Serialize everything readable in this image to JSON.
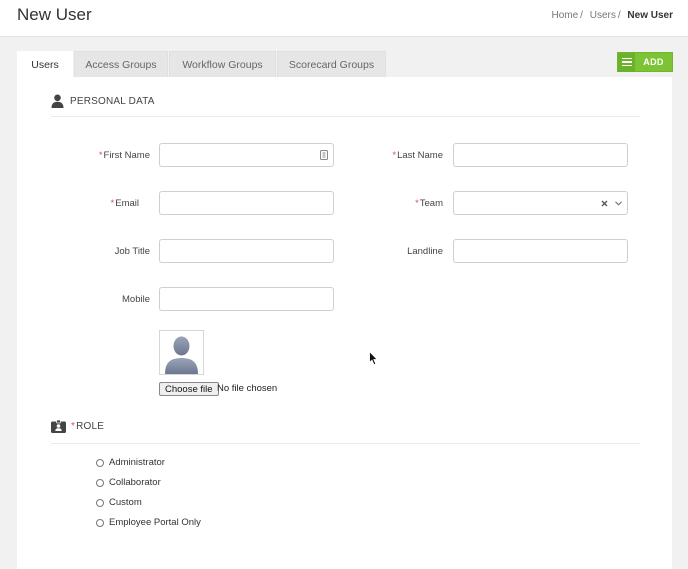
{
  "header": {
    "title": "New User",
    "breadcrumb": [
      {
        "label": "Home"
      },
      {
        "label": "Users"
      },
      {
        "label": "New User"
      }
    ],
    "separator": "/"
  },
  "tabs": [
    {
      "label": "Users",
      "active": true
    },
    {
      "label": "Access Groups",
      "active": false
    },
    {
      "label": "Workflow Groups",
      "active": false
    },
    {
      "label": "Scorecard Groups",
      "active": false
    }
  ],
  "toolbar": {
    "add_label": "ADD",
    "add_color": "#7cc436"
  },
  "personal": {
    "heading": "PERSONAL DATA",
    "icon": "person-icon",
    "required_mark": "*",
    "fields": {
      "first_name": {
        "label": "First Name",
        "value": "",
        "required": true
      },
      "last_name": {
        "label": "Last Name",
        "value": "",
        "required": true
      },
      "email": {
        "label": "Email",
        "value": "",
        "required": true
      },
      "team": {
        "label": "Team",
        "value": "",
        "required": true
      },
      "job_title": {
        "label": "Job Title",
        "value": "",
        "required": false
      },
      "landline": {
        "label": "Landline",
        "value": "",
        "required": false
      },
      "mobile": {
        "label": "Mobile",
        "value": "",
        "required": false
      }
    },
    "photo": {
      "choose_label": "Choose file",
      "status": "No file chosen"
    }
  },
  "role": {
    "heading": "ROLE",
    "icon": "id-badge-icon",
    "options": [
      {
        "label": "Administrator",
        "selected": false
      },
      {
        "label": "Collaborator",
        "selected": false
      },
      {
        "label": "Custom",
        "selected": false
      },
      {
        "label": "Employee Portal Only",
        "selected": false
      }
    ]
  }
}
